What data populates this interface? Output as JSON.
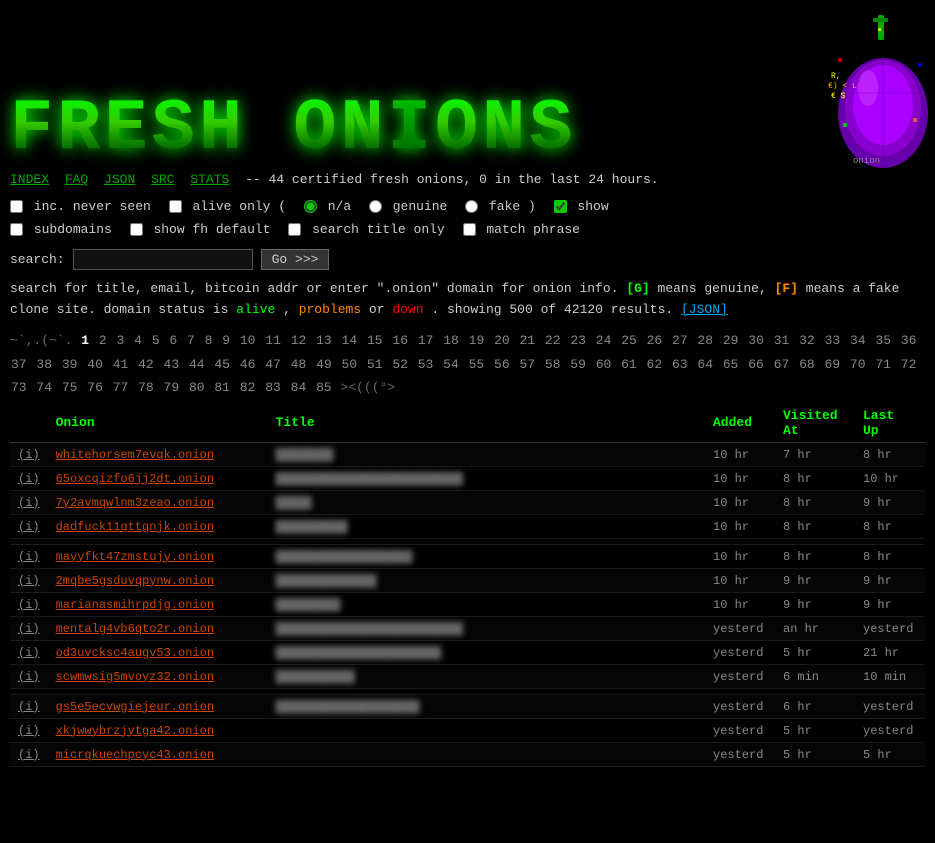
{
  "header": {
    "logo": "FRESH ONIONS",
    "tagline": "-- 44 certified fresh onions, 0 in the last 24 hours."
  },
  "nav": {
    "items": [
      {
        "label": "INDEX",
        "href": "#"
      },
      {
        "label": "FAQ",
        "href": "#"
      },
      {
        "label": "JSON",
        "href": "#"
      },
      {
        "label": "SRC",
        "href": "#"
      },
      {
        "label": "STATS",
        "href": "#"
      }
    ]
  },
  "options": {
    "inc_never_seen_label": "inc. never seen",
    "alive_only_label": "alive only (",
    "na_label": "n/a",
    "genuine_label": "genuine",
    "fake_label": "fake )",
    "show_label": "show",
    "subdomains_label": "subdomains",
    "show_fh_label": "show fh default",
    "search_title_label": "search title only",
    "match_phrase_label": "match phrase"
  },
  "search": {
    "label": "search:",
    "placeholder": "",
    "button": "Go >>>"
  },
  "info": {
    "text1": "search for title, email, bitcoin addr or enter \".onion\" domain for onion info.",
    "genuine_marker": "[G]",
    "genuine_desc": "means genuine,",
    "fake_marker": "[F]",
    "fake_desc": "means a fake clone site. domain status is",
    "alive": "alive",
    "problems": "problems",
    "or": "or",
    "down": "down",
    "showing": ". showing 500 of 42120 results.",
    "json_link": "[JSON]"
  },
  "pagination": {
    "prefix": "~`,.(~`.",
    "current": "1",
    "pages": [
      "2",
      "3",
      "4",
      "5",
      "6",
      "7",
      "8",
      "9",
      "10",
      "11",
      "12",
      "13",
      "14",
      "15",
      "16",
      "17",
      "18",
      "19",
      "20",
      "21",
      "22",
      "23",
      "24",
      "25",
      "26",
      "27",
      "28",
      "29",
      "30",
      "31",
      "32",
      "33",
      "34",
      "35",
      "36",
      "37",
      "38",
      "39",
      "40",
      "41",
      "42",
      "43",
      "44",
      "45",
      "46",
      "47",
      "48",
      "49",
      "50",
      "51",
      "52",
      "53",
      "54",
      "55",
      "56",
      "57",
      "58",
      "59",
      "60",
      "61",
      "62",
      "63",
      "64",
      "65",
      "66",
      "67",
      "68",
      "69",
      "70",
      "71",
      "72",
      "73",
      "74",
      "75",
      "76",
      "77",
      "78",
      "79",
      "80",
      "81",
      "82",
      "83",
      "84",
      "85"
    ],
    "suffix": "><(((°>"
  },
  "table": {
    "headers": [
      "Onion",
      "Title",
      "Added",
      "Visited At",
      "Last Up"
    ],
    "rows": [
      {
        "info": "(i)",
        "onion": "whitehorsem7evqk.onion",
        "title": "████████",
        "added": "10 hr",
        "visited": "7 hr",
        "lastup": "8 hr",
        "gap": false
      },
      {
        "info": "(i)",
        "onion": "65oxcqizfo6jj2dt.onion",
        "title": "██████████████████████████",
        "added": "10 hr",
        "visited": "8 hr",
        "lastup": "10 hr",
        "gap": false
      },
      {
        "info": "(i)",
        "onion": "7y2avmqwlnm3zeao.onion",
        "title": "█████",
        "added": "10 hr",
        "visited": "8 hr",
        "lastup": "9 hr",
        "gap": false
      },
      {
        "info": "(i)",
        "onion": "dadfuck11qttgnjk.onion",
        "title": "██████████",
        "added": "10 hr",
        "visited": "8 hr",
        "lastup": "8 hr",
        "gap": false
      },
      {
        "info": "(i)",
        "onion": "mayyfkt47zmstujy.onion",
        "title": "███████████████████",
        "added": "10 hr",
        "visited": "8 hr",
        "lastup": "8 hr",
        "gap": true
      },
      {
        "info": "(i)",
        "onion": "2mqbe5gsduvqpynw.onion",
        "title": "██████████████",
        "added": "10 hr",
        "visited": "9 hr",
        "lastup": "9 hr",
        "gap": false
      },
      {
        "info": "(i)",
        "onion": "marianasmihrpdjg.onion",
        "title": "█████████",
        "added": "10 hr",
        "visited": "9 hr",
        "lastup": "9 hr",
        "gap": false
      },
      {
        "info": "(i)",
        "onion": "mentalg4vb6qto2r.onion",
        "title": "██████████████████████████",
        "added": "yesterd",
        "visited": "an hr",
        "lastup": "yesterd",
        "gap": false
      },
      {
        "info": "(i)",
        "onion": "od3uvcksc4augv53.onion",
        "title": "███████████████████████",
        "added": "yesterd",
        "visited": "5 hr",
        "lastup": "21 hr",
        "gap": false
      },
      {
        "info": "(i)",
        "onion": "scwmwsig5mvoyz32.onion",
        "title": "███████████",
        "added": "yesterd",
        "visited": "6 min",
        "lastup": "10 min",
        "gap": false
      },
      {
        "info": "(i)",
        "onion": "gs5e5ecvwgiejeur.onion",
        "title": "████████████████████",
        "added": "yesterd",
        "visited": "6 hr",
        "lastup": "yesterd",
        "gap": true
      },
      {
        "info": "(i)",
        "onion": "xkjwwybrzjytga42.onion",
        "title": "",
        "added": "yesterd",
        "visited": "5 hr",
        "lastup": "yesterd",
        "gap": false
      },
      {
        "info": "(i)",
        "onion": "micrqkuechpcyc43.onion",
        "title": "",
        "added": "yesterd",
        "visited": "5 hr",
        "lastup": "5 hr",
        "gap": false
      }
    ]
  },
  "onion_ascii": {
    "art": "    [N$\n   .$  $.\n  .$    $.\n  $  /\\ $\nR.$ E} < L$\nE $  \\/ $\n  $.    .$\n   '$  $'\n    '$$'\n   onion",
    "colors": [
      "#ff0000",
      "#ff8800",
      "#ffff00",
      "#00ff00",
      "#0000ff",
      "#8800ff"
    ]
  }
}
